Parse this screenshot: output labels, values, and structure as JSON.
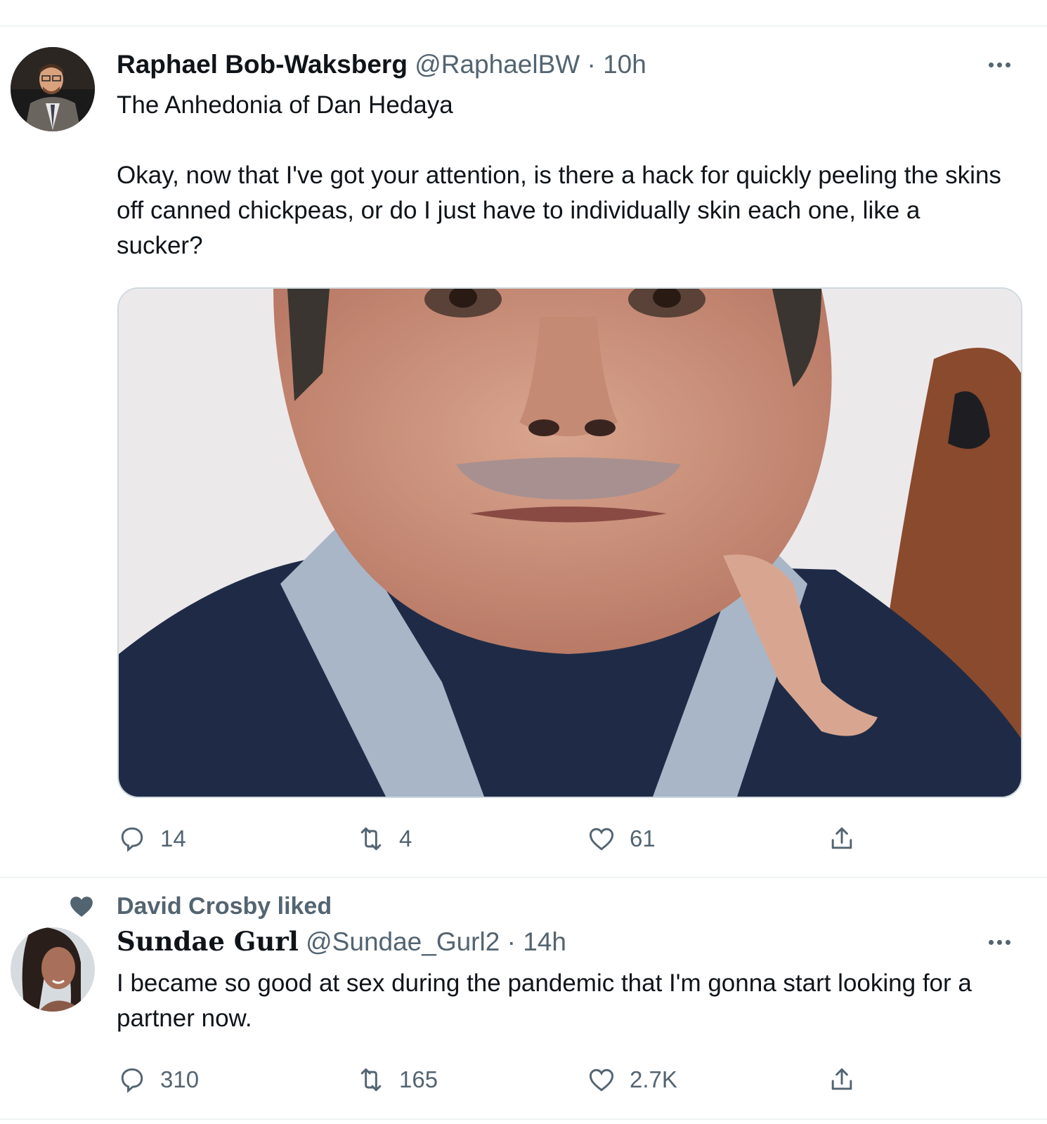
{
  "tweets": [
    {
      "author_name": "Raphael Bob-Waksberg",
      "handle": "@RaphaelBW",
      "separator": "·",
      "time": "10h",
      "text": "The Anhedonia of Dan Hedaya\n\nOkay, now that I've got your attention, is there a hack for quickly peeling the skins off canned chickpeas, or do I just have to individually skin each one, like a sucker?",
      "has_media": true,
      "actions": {
        "replies": "14",
        "retweets": "4",
        "likes": "61"
      }
    },
    {
      "context_icon": "heart-icon",
      "context_text": "David Crosby liked",
      "author_name": "Sundae Gurl",
      "handle": "@Sundae_Gurl2",
      "separator": "·",
      "time": "14h",
      "text": "I became so good at sex during the pandemic that I'm gonna start looking for a partner now.",
      "actions": {
        "replies": "310",
        "retweets": "165",
        "likes": "2.7K"
      }
    }
  ],
  "colors": {
    "text": "#0f1419",
    "secondary": "#536471",
    "divider": "#eff3f4"
  }
}
